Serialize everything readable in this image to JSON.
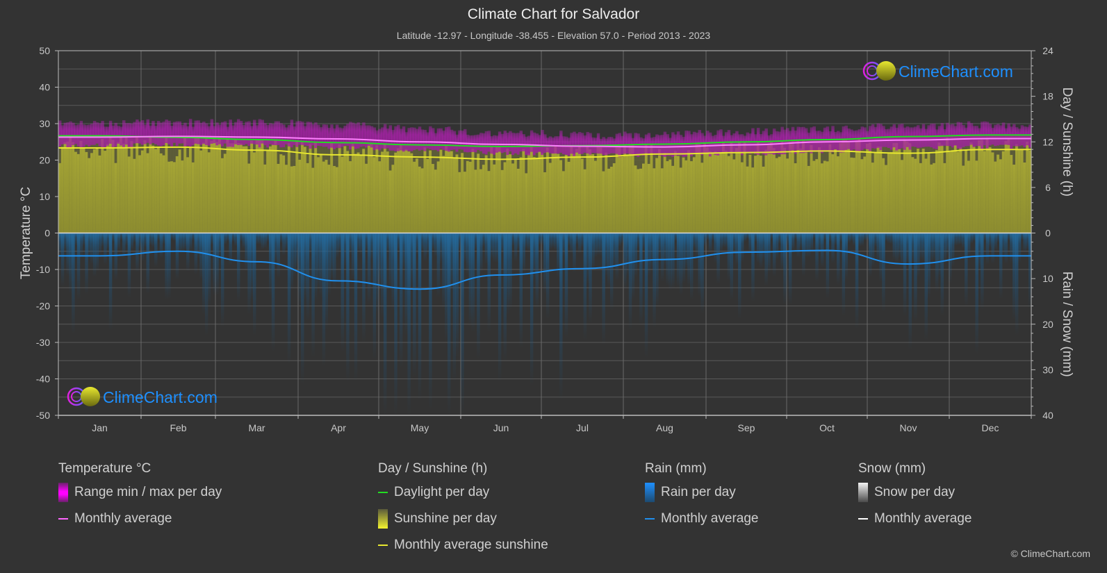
{
  "title": "Climate Chart for Salvador",
  "subtitle": "Latitude -12.97 - Longitude -38.455 - Elevation 57.0 - Period 2013 - 2023",
  "watermark": "ClimeChart.com",
  "copyright": "© ClimeChart.com",
  "colors": {
    "background": "#333333",
    "temp_range": "#c020c0",
    "temp_avg": "#ff80ff",
    "daylight": "#22dd22",
    "sunshine_fill": "#9a9a30",
    "sunshine_avg": "#e8e830",
    "rain_fill": "#1f6fa8",
    "rain_avg": "#2090ee",
    "snow_avg": "#ffffff",
    "logo_text": "#1e90ff"
  },
  "legend": {
    "temperature": {
      "title": "Temperature °C",
      "items": [
        "Range min / max per day",
        "Monthly average"
      ]
    },
    "sunshine": {
      "title": "Day / Sunshine (h)",
      "items": [
        "Daylight per day",
        "Sunshine per day",
        "Monthly average sunshine"
      ]
    },
    "rain": {
      "title": "Rain (mm)",
      "items": [
        "Rain per day",
        "Monthly average"
      ]
    },
    "snow": {
      "title": "Snow (mm)",
      "items": [
        "Snow per day",
        "Monthly average"
      ]
    }
  },
  "chart_data": {
    "type": "line",
    "title": "Climate Chart for Salvador",
    "categories": [
      "Jan",
      "Feb",
      "Mar",
      "Apr",
      "May",
      "Jun",
      "Jul",
      "Aug",
      "Sep",
      "Oct",
      "Nov",
      "Dec"
    ],
    "axes": {
      "left": {
        "label": "Temperature °C",
        "range": [
          -50,
          50
        ],
        "ticks": [
          "50",
          "40",
          "30",
          "20",
          "10",
          "0",
          "-10",
          "-20",
          "-30",
          "-40",
          "-50"
        ]
      },
      "right_top": {
        "label": "Day / Sunshine (h)",
        "range": [
          0,
          24
        ],
        "ticks": [
          "24",
          "18",
          "12",
          "6",
          "0"
        ]
      },
      "right_bottom": {
        "label": "Rain / Snow (mm)",
        "range": [
          0,
          40
        ],
        "ticks": [
          "10",
          "20",
          "30",
          "40"
        ]
      }
    },
    "grid": true,
    "legend_position": "bottom",
    "series": [
      {
        "name": "Temperature monthly average",
        "axis": "left",
        "unit": "°C",
        "values": [
          26.3,
          26.5,
          26.3,
          25.8,
          25.0,
          24.3,
          23.8,
          23.6,
          24.2,
          25.0,
          25.5,
          25.9
        ]
      },
      {
        "name": "Temperature daily max (approx)",
        "axis": "left",
        "unit": "°C",
        "values": [
          29.5,
          29.8,
          29.8,
          29.0,
          28.0,
          27.0,
          26.5,
          26.5,
          27.3,
          28.2,
          28.8,
          29.2
        ]
      },
      {
        "name": "Temperature daily min (approx)",
        "axis": "left",
        "unit": "°C",
        "values": [
          24.0,
          24.2,
          24.0,
          23.5,
          22.8,
          22.0,
          21.5,
          21.3,
          21.8,
          22.5,
          23.2,
          23.7
        ]
      },
      {
        "name": "Daylight per day",
        "axis": "right_top",
        "unit": "h",
        "values": [
          12.8,
          12.6,
          12.3,
          11.9,
          11.6,
          11.4,
          11.5,
          11.7,
          12.0,
          12.3,
          12.7,
          12.9
        ]
      },
      {
        "name": "Monthly average sunshine",
        "axis": "right_top",
        "unit": "h",
        "values": [
          11.2,
          11.3,
          10.9,
          10.3,
          10.0,
          9.7,
          10.0,
          10.4,
          10.6,
          10.8,
          10.5,
          11.0
        ]
      },
      {
        "name": "Rain monthly average",
        "axis": "right_bottom",
        "unit": "mm",
        "values": [
          5.0,
          4.0,
          6.3,
          10.5,
          12.3,
          9.2,
          7.8,
          5.8,
          4.2,
          3.8,
          6.8,
          5.0
        ]
      },
      {
        "name": "Snow monthly average",
        "axis": "right_bottom",
        "unit": "mm",
        "values": [
          0,
          0,
          0,
          0,
          0,
          0,
          0,
          0,
          0,
          0,
          0,
          0
        ]
      }
    ]
  }
}
